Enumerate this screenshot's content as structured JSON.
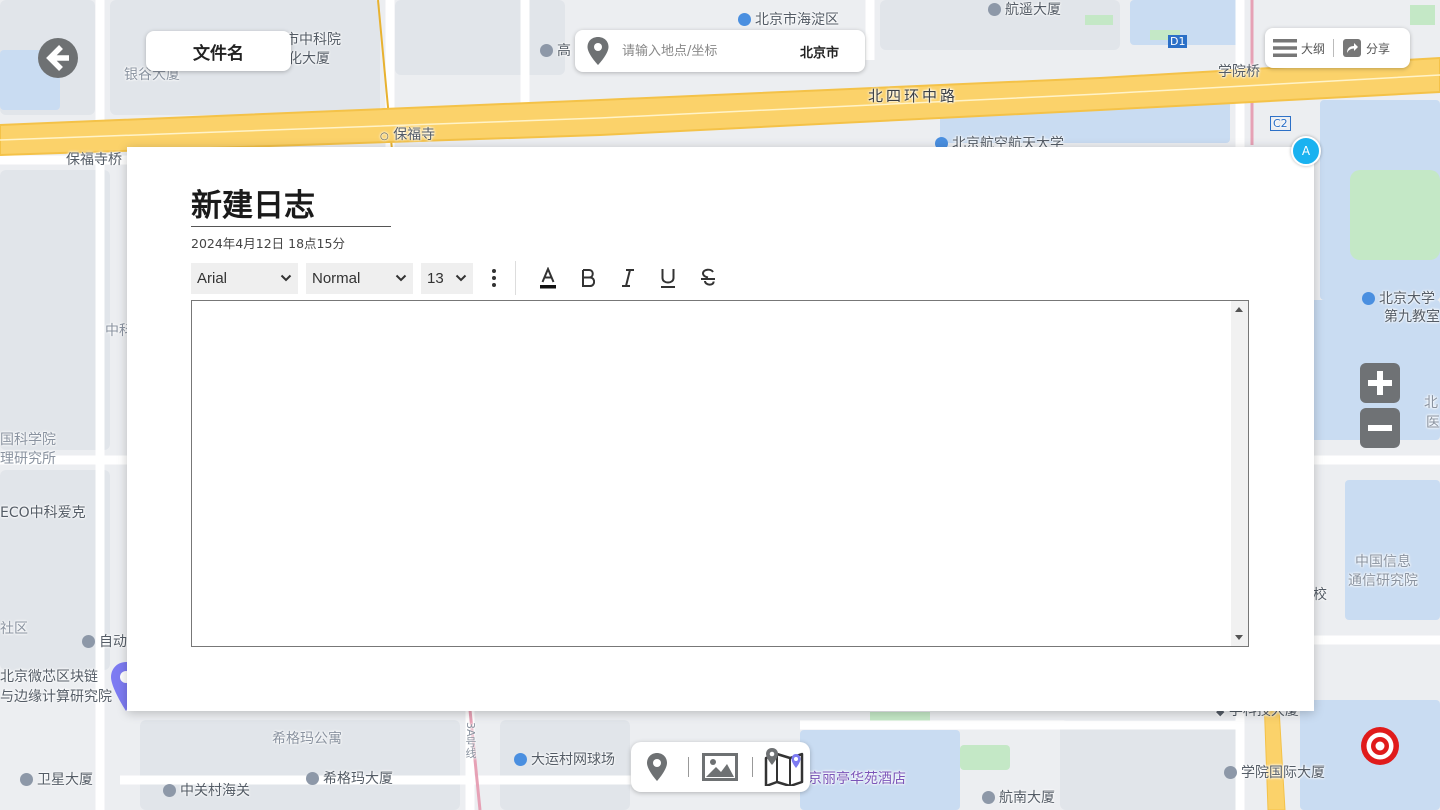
{
  "map": {
    "labels": {
      "haidian_district": "北京市海淀区",
      "hangyao": "航遥大厦",
      "zhongke": "市中科院",
      "wenhua": "化大厦",
      "gao": "高",
      "yingu": "银谷大厦",
      "d1": "D1",
      "xueyuanqiao": "学院桥",
      "beisihuan": "北四环中路",
      "baofusi": "保福寺",
      "baofusiqiao": "保福寺桥",
      "beihang": "北京航空航天大学",
      "c2": "C2",
      "pku_1": "北京大学",
      "pku_2": "第九教室",
      "bei": "北",
      "yi": "医",
      "zhongke_2": "中科",
      "kexueyuan_1": "国科学院",
      "kexueyuan_2": "理研究所",
      "eco": "ECO中科爱克",
      "shequ": "社区",
      "zidong": "自动",
      "weixin_1": "北京微芯区块链",
      "weixin_2": "与边缘计算研究院",
      "xinxi_1": "中国信息",
      "xinxi_2": "通信研究院",
      "xiao": "校",
      "xigema": "希格玛公寓",
      "dayuncun": "大运村网球场",
      "lijing": "京丽亭华苑酒店",
      "xuekejidaxue": "学科技大厦",
      "weixing": "卫星大厦",
      "zhongguancun": "中关村海关",
      "xigema_2": "希格玛大厦",
      "xueyuan_intl": "学院国际大厦",
      "hangnan": "航南大厦",
      "hangxian": "3A号线"
    }
  },
  "header": {
    "file_button": "文件名",
    "search": {
      "placeholder": "请输入地点/坐标",
      "value": "",
      "city": "北京市"
    },
    "outline_label": "大纲",
    "share_label": "分享"
  },
  "dialog": {
    "title": "新建日志",
    "date": "2024年4月12日 18点15分",
    "toolbar": {
      "font": "Arial",
      "style": "Normal",
      "size": "13"
    },
    "content": ""
  },
  "avatar": {
    "letter": "A"
  },
  "colors": {
    "road_major": "#fbd26a",
    "road_major_edge": "#f4c248",
    "avatar_bg": "#1ab2f0",
    "pin_purple": "#7d7bf2",
    "target_red": "#e01b1b",
    "zoom_bg": "#6f7275"
  },
  "icons": {
    "back": "arrow-left-circle-icon",
    "search": "map-pin-icon",
    "outline": "menu-icon",
    "share": "share-icon",
    "zoom_in": "plus-icon",
    "zoom_out": "minus-icon",
    "bottom": [
      "map-pin-icon",
      "image-icon",
      "map-route-icon"
    ],
    "target": "target-icon",
    "location_pin": "location-pin-icon"
  }
}
